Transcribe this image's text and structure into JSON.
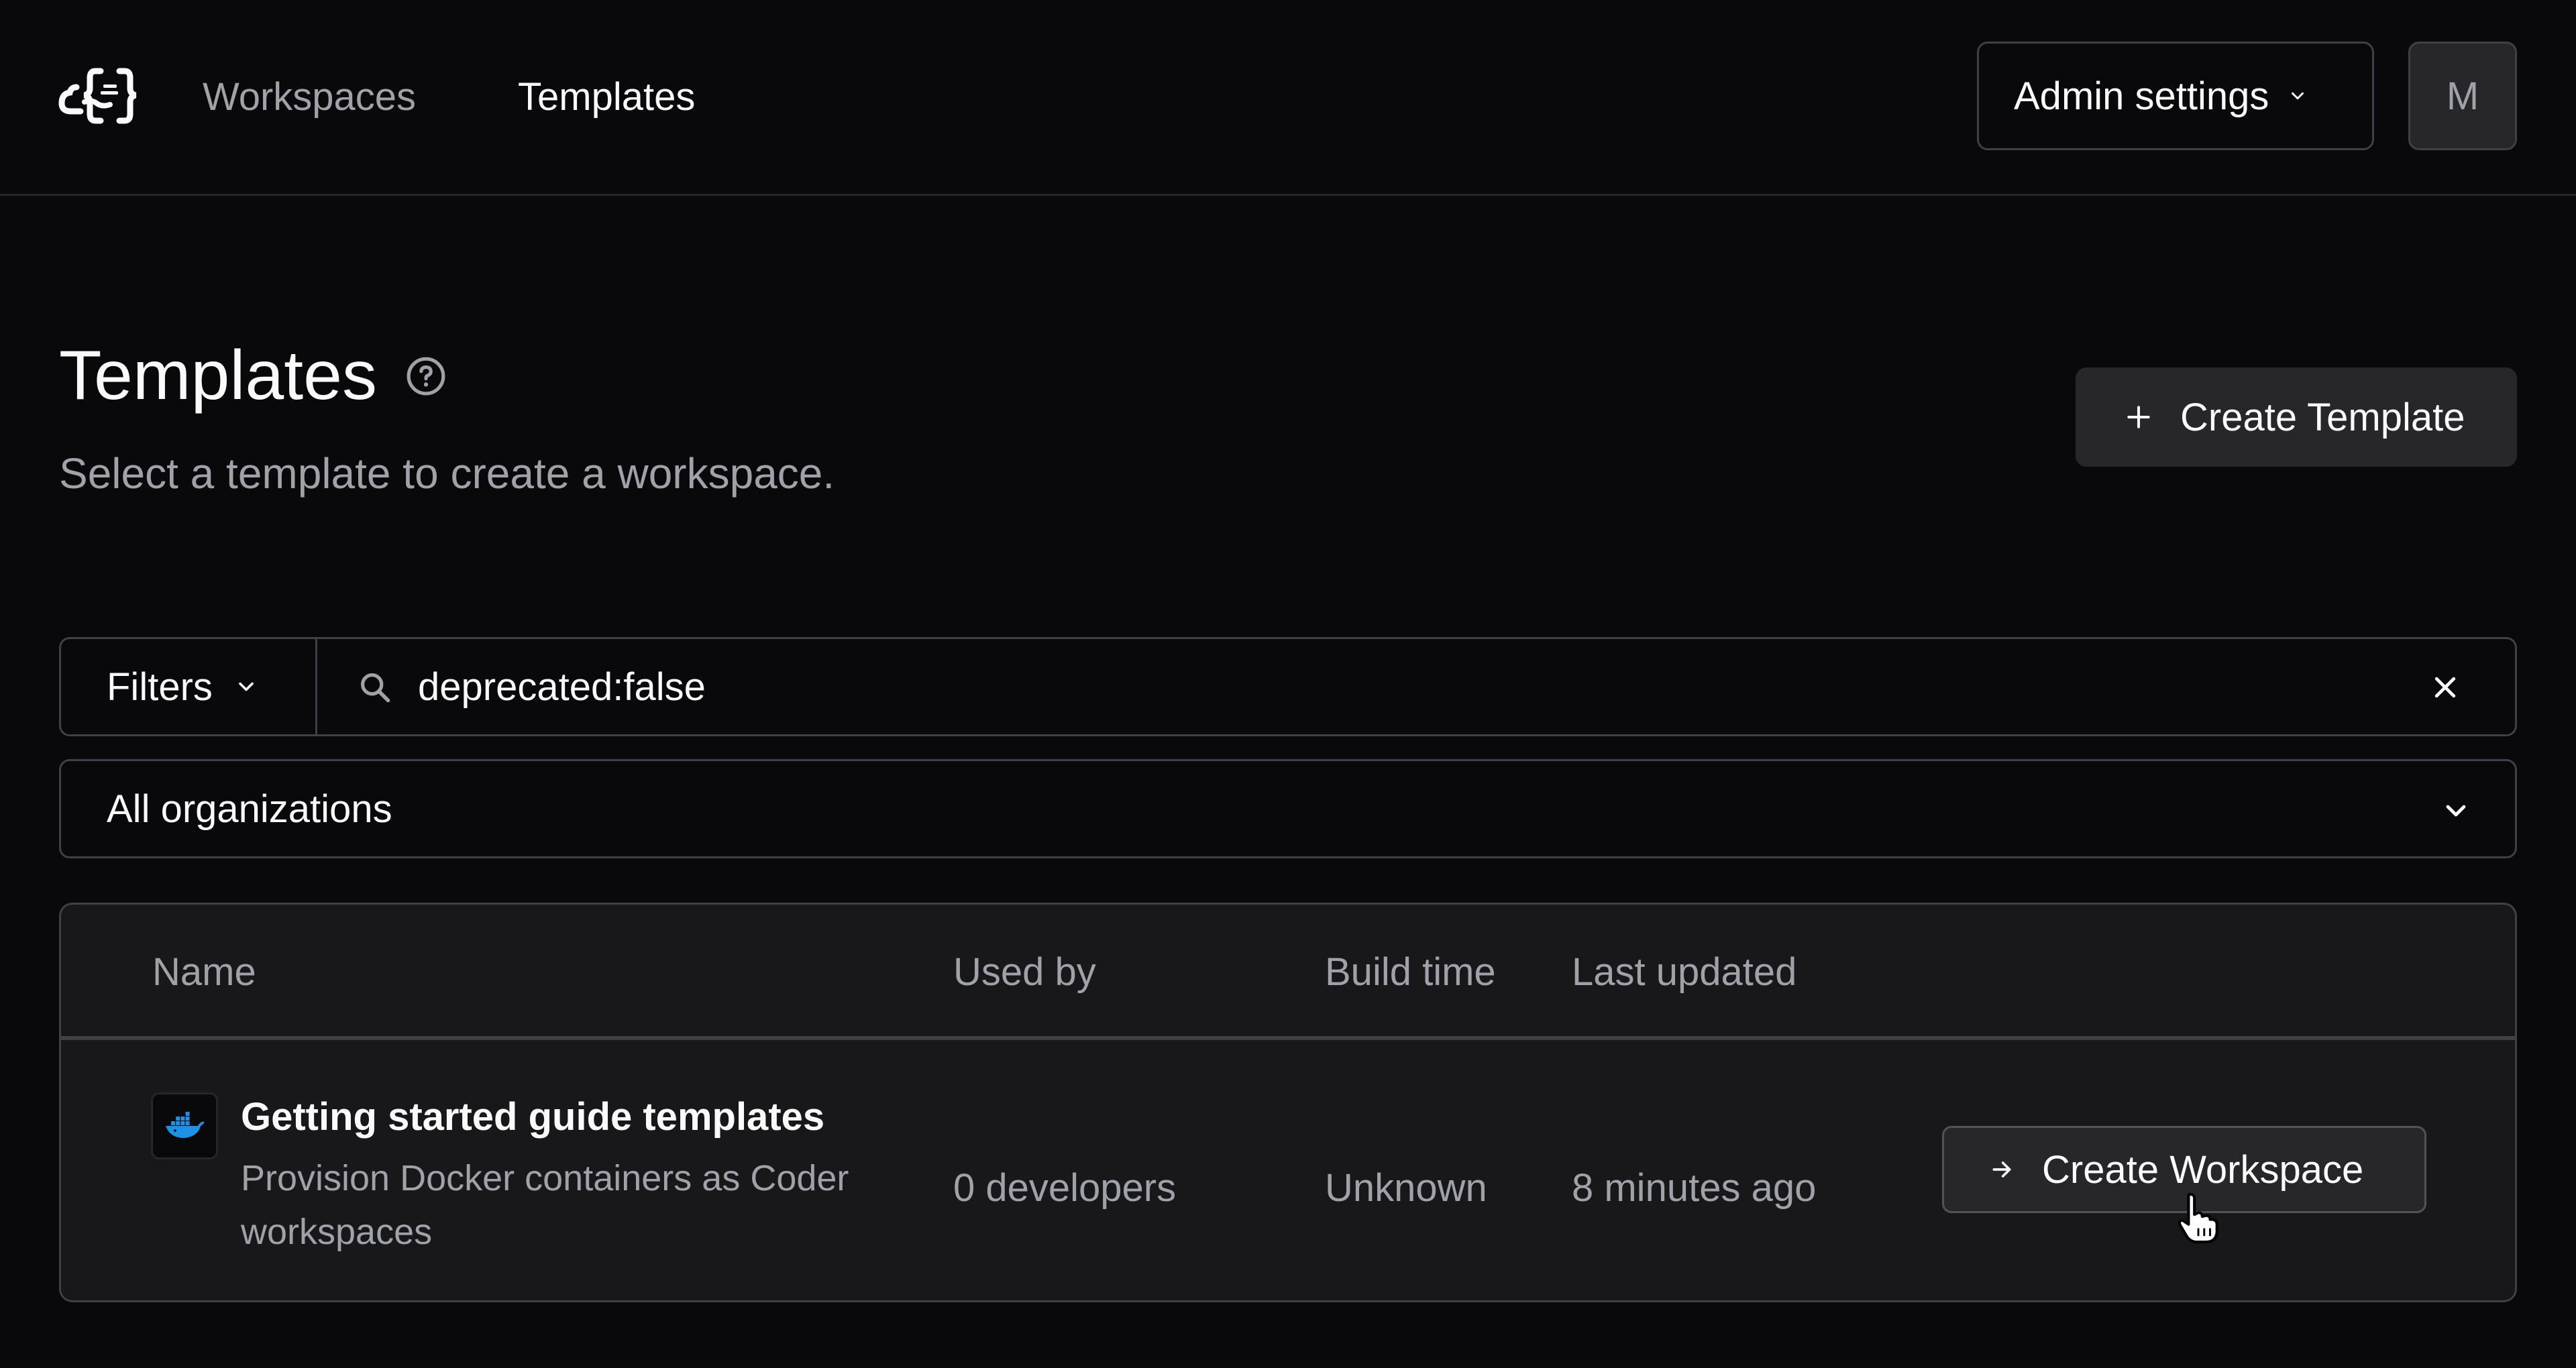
{
  "header": {
    "nav": [
      {
        "label": "Workspaces",
        "active": false
      },
      {
        "label": "Templates",
        "active": true
      }
    ],
    "admin_settings_label": "Admin settings",
    "avatar_initial": "M"
  },
  "page": {
    "title": "Templates",
    "subtitle": "Select a template to create a workspace.",
    "create_template_label": "Create Template"
  },
  "filter": {
    "filters_label": "Filters",
    "search_value": "deprecated:false",
    "organization_value": "All organizations"
  },
  "table": {
    "columns": [
      "Name",
      "Used by",
      "Build time",
      "Last updated"
    ],
    "rows": [
      {
        "name": "Getting started guide templates",
        "description": "Provision Docker containers as Coder workspaces",
        "used_by": "0 developers",
        "build_time": "Unknown",
        "last_updated": "8 minutes ago",
        "action_label": "Create Workspace",
        "icon": "docker-icon"
      }
    ]
  },
  "colors": {
    "background": "#09090b",
    "surface": "#18181b",
    "border": "#3f3f46",
    "muted_text": "#a1a1aa",
    "text": "#fafafa",
    "docker_blue": "#1d91e6"
  }
}
